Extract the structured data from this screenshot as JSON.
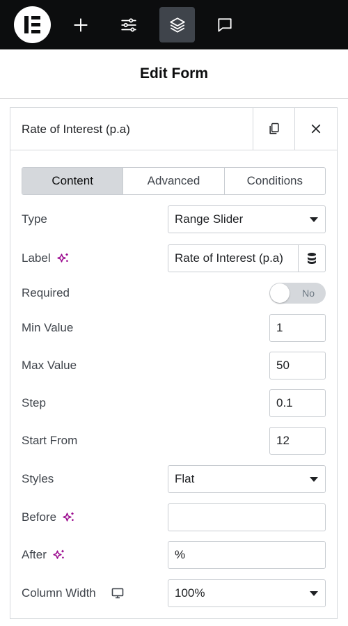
{
  "topbar": {
    "icons": [
      "elementor-logo-icon",
      "plus-icon",
      "sliders-icon",
      "layers-icon",
      "chat-icon"
    ],
    "active_icon": "layers-icon"
  },
  "header": {
    "title": "Edit Form"
  },
  "panel": {
    "title": "Rate of Interest (p.a)",
    "tabs": [
      {
        "label": "Content",
        "active": true
      },
      {
        "label": "Advanced",
        "active": false
      },
      {
        "label": "Conditions",
        "active": false
      }
    ],
    "fields": {
      "type": {
        "label": "Type",
        "value": "Range Slider"
      },
      "label": {
        "label": "Label",
        "value": "Rate of Interest (p.a)"
      },
      "required": {
        "label": "Required",
        "state": "No"
      },
      "min_value": {
        "label": "Min Value",
        "value": "1"
      },
      "max_value": {
        "label": "Max Value",
        "value": "50"
      },
      "step": {
        "label": "Step",
        "value": "0.1"
      },
      "start_from": {
        "label": "Start From",
        "value": "12"
      },
      "styles": {
        "label": "Styles",
        "value": "Flat"
      },
      "before": {
        "label": "Before",
        "value": ""
      },
      "after": {
        "label": "After",
        "value": "%"
      },
      "column_width": {
        "label": "Column Width",
        "value": "100%"
      }
    }
  },
  "colors": {
    "topbar_bg": "#0c0d0e",
    "active_tab_bg": "#d5d8dc",
    "ai_accent": "#9b0a8e",
    "border": "#c8ccd1"
  }
}
